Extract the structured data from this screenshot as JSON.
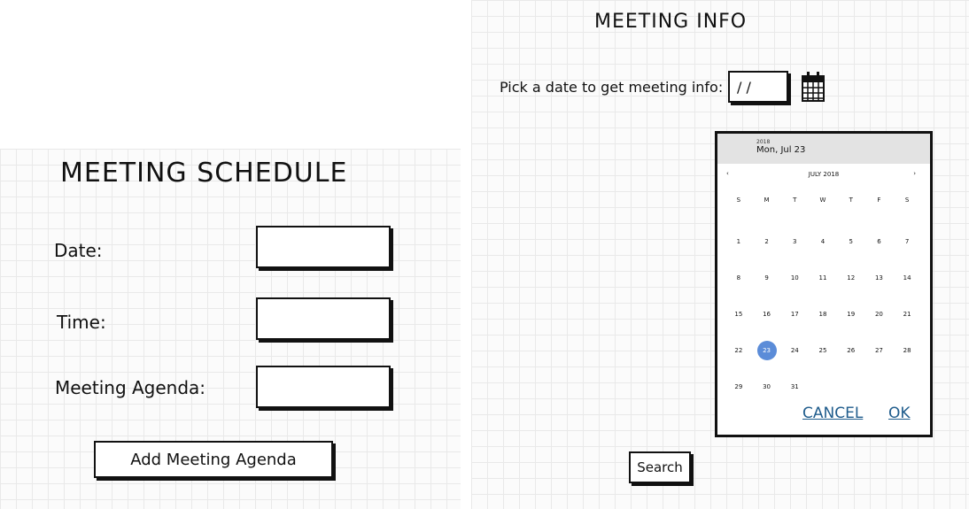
{
  "schedule": {
    "title": "MEETING SCHEDULE",
    "date_label": "Date:",
    "time_label": "Time:",
    "agenda_label": "Meeting Agenda:",
    "add_button": "Add Meeting Agenda"
  },
  "info": {
    "title": "MEETING INFO",
    "pick_label": "Pick a date to get meeting info:",
    "date_value": "/ /",
    "search_button": "Search",
    "calendar_icon": "calendar-icon"
  },
  "datepicker": {
    "year": "2018",
    "selected_label": "Mon, Jul 23",
    "month_label": "JULY 2018",
    "prev": "‹",
    "next": "›",
    "weekdays": [
      "S",
      "M",
      "T",
      "W",
      "T",
      "F",
      "S"
    ],
    "days": [
      "1",
      "2",
      "3",
      "4",
      "5",
      "6",
      "7",
      "8",
      "9",
      "10",
      "11",
      "12",
      "13",
      "14",
      "15",
      "16",
      "17",
      "18",
      "19",
      "20",
      "21",
      "22",
      "23",
      "24",
      "25",
      "26",
      "27",
      "28",
      "29",
      "30",
      "31"
    ],
    "selected_day": "23",
    "cancel": "CANCEL",
    "ok": "OK",
    "accent_color": "#5b8cd8",
    "action_color": "#1f5c8c"
  }
}
